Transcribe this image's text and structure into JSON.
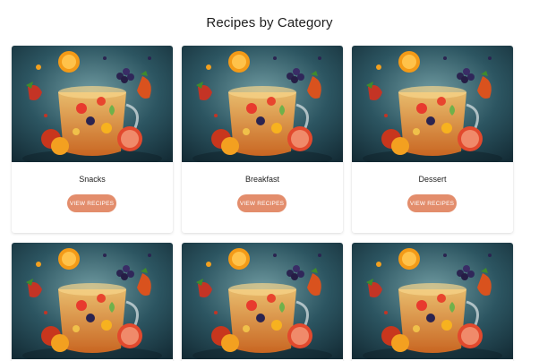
{
  "page": {
    "title": "Recipes by Category"
  },
  "cards": [
    {
      "title": "Snacks",
      "button": "VIEW RECIPES"
    },
    {
      "title": "Breakfast",
      "button": "VIEW RECIPES"
    },
    {
      "title": "Dessert",
      "button": "VIEW RECIPES"
    },
    {
      "title": "",
      "button": ""
    },
    {
      "title": "",
      "button": ""
    },
    {
      "title": "",
      "button": ""
    }
  ],
  "colors": {
    "button_bg": "#e38d6c",
    "image_bg": "#1f4653"
  },
  "image_icon": "fruit-splash-image"
}
